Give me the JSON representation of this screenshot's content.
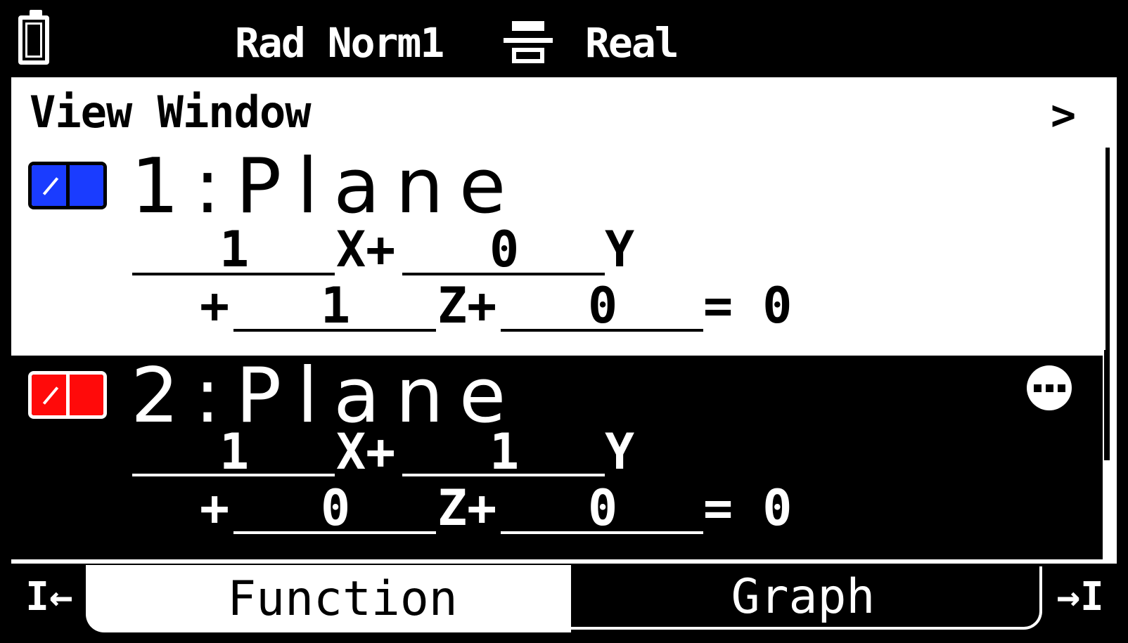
{
  "status": {
    "angle_format": "Rad Norm1",
    "complex_mode": "Real",
    "icons": [
      "battery-icon",
      "fraction-display-icon"
    ]
  },
  "header": {
    "title": "View Window",
    "chevron": ">"
  },
  "functions": [
    {
      "title": "1:Plane",
      "color": "#1a3cff",
      "selected": false,
      "equation": {
        "a": "1",
        "x_term": "X+",
        "b": "0",
        "y_term": "Y",
        "plus": "+",
        "c": "1",
        "z_term": "Z+",
        "d": "0",
        "eq": "= 0"
      }
    },
    {
      "title": "2:Plane",
      "color": "#ff0a0a",
      "selected": true,
      "equation": {
        "a": "1",
        "x_term": "X+",
        "b": "1",
        "y_term": "Y",
        "plus": "+",
        "c": "0",
        "z_term": "Z+",
        "d": "0",
        "eq": "= 0"
      }
    }
  ],
  "tabs": {
    "left_arrow": "I←",
    "function": "Function",
    "graph": "Graph",
    "right_arrow": "→I"
  }
}
